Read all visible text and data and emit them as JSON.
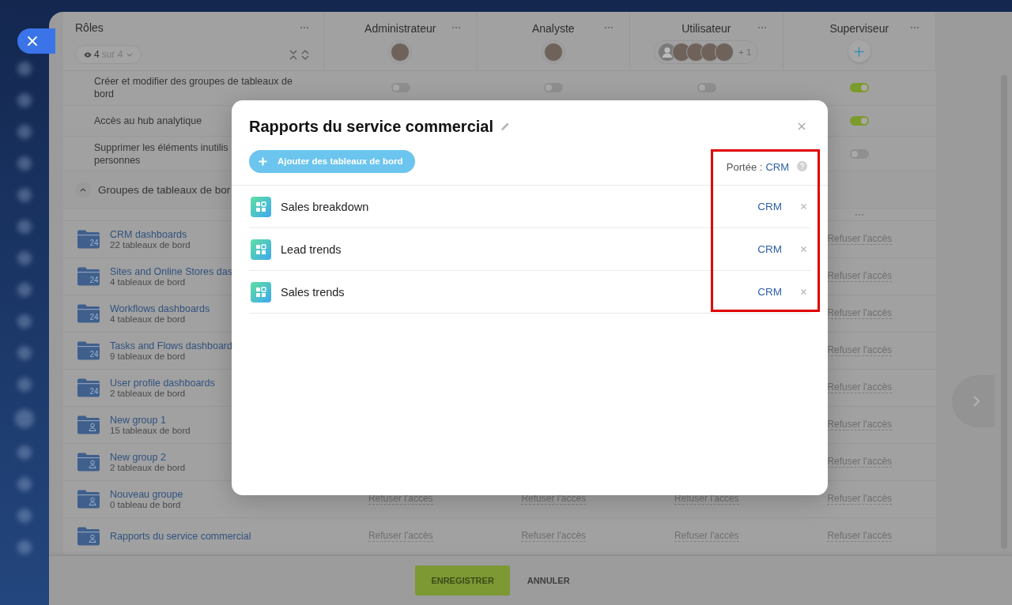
{
  "roles_table": {
    "first_column_title": "Rôles",
    "visible_count": "4",
    "visible_of": "sur 4",
    "roles": [
      {
        "name": "Administrateur",
        "members": [
          {
            "kind": "photo"
          }
        ]
      },
      {
        "name": "Analyste",
        "members": [
          {
            "kind": "photo"
          }
        ]
      },
      {
        "name": "Utilisateur",
        "members": [
          {
            "kind": "silhouette"
          },
          {
            "kind": "photo"
          },
          {
            "kind": "photo"
          },
          {
            "kind": "photo"
          },
          {
            "kind": "photo"
          }
        ],
        "more": "+ 1"
      },
      {
        "name": "Superviseur"
      }
    ],
    "permissions": [
      {
        "label_lines": [
          "Créer et modifier des groupes de tableaux de",
          "bord"
        ],
        "cells": {
          "column_1": {
            "kind": "toggle",
            "on": false
          },
          "column_2": {
            "kind": "toggle",
            "on": false
          },
          "column_3": {
            "kind": "toggle",
            "on": false
          },
          "column_4": {
            "kind": "toggle",
            "on": true
          }
        }
      },
      {
        "label_lines": [
          "Accès au hub analytique"
        ],
        "cells": {
          "column_4": {
            "kind": "toggle",
            "on": true
          }
        }
      },
      {
        "label_lines": [
          "Supprimer les éléments inutilis",
          "personnes"
        ],
        "cells": {
          "column_4": {
            "kind": "toggle",
            "on": false
          }
        }
      }
    ],
    "groups_section": {
      "title": "Groupes de tableaux de bor",
      "expanded": true,
      "groups": [
        {
          "name": "CRM dashboards",
          "count": "22 tableaux de bord",
          "kind": "system",
          "folder_mark": "24",
          "access": {
            "column_4": "Refuser l'accès"
          }
        },
        {
          "name": "Sites and Online Stores das",
          "count": "4 tableaux de bord",
          "kind": "system",
          "folder_mark": "24",
          "access": {
            "column_4": "Refuser l'accès"
          }
        },
        {
          "name": "Workflows dashboards",
          "count": "4 tableaux de bord",
          "kind": "system",
          "folder_mark": "24",
          "access": {
            "column_4": "Refuser l'accès"
          }
        },
        {
          "name": "Tasks and Flows dashboard",
          "count": "9 tableaux de bord",
          "kind": "system",
          "folder_mark": "24",
          "access": {
            "column_4": "Refuser l'accès"
          }
        },
        {
          "name": "User profile dashboards",
          "count": "2 tableaux de bord",
          "kind": "system",
          "folder_mark": "24",
          "access": {
            "column_4": "Refuser l'accès"
          }
        },
        {
          "name": "New group 1",
          "count": "15 tableaux de bord",
          "kind": "custom",
          "access": {
            "column_4": "Refuser l'accès"
          }
        },
        {
          "name": "New group 2",
          "count": "2 tableaux de bord",
          "kind": "custom",
          "access": {
            "column_4": "Refuser l'accès"
          }
        },
        {
          "name": "Nouveau groupe",
          "count": "0 tableau de bord",
          "kind": "custom",
          "access": {
            "column_1": "Refuser l'accès",
            "column_2": "Refuser l'accès",
            "column_3": "Refuser l'accès",
            "column_4": "Refuser l'accès"
          }
        },
        {
          "name": "Rapports du service commercial",
          "kind": "custom",
          "access": {
            "column_1": "Refuser l'accès",
            "column_2": "Refuser l'accès",
            "column_3": "Refuser l'accès",
            "column_4": "Refuser l'accès"
          }
        }
      ]
    }
  },
  "footer": {
    "save": "ENREGISTRER",
    "cancel": "ANNULER"
  },
  "dialog": {
    "title": "Rapports du service commercial",
    "add_button": "Ajouter des tableaux de bord",
    "scope_label": "Portée :",
    "scope_value": "CRM",
    "dashboards": [
      {
        "name": "Sales breakdown",
        "scope": "CRM"
      },
      {
        "name": "Lead trends",
        "scope": "CRM"
      },
      {
        "name": "Sales trends",
        "scope": "CRM"
      }
    ]
  }
}
